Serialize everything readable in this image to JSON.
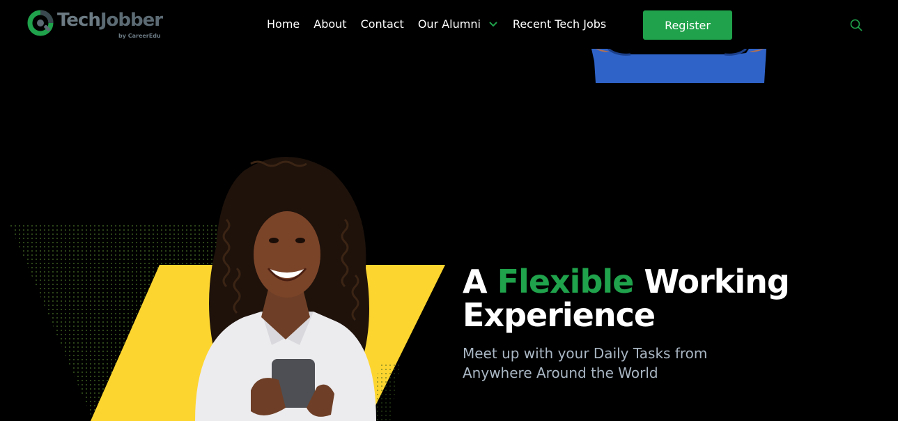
{
  "brand": {
    "name_part1": "Tech",
    "name_part2": "Jobber",
    "sub": "by CareerEdu",
    "accent_color": "#1fa24b"
  },
  "nav": {
    "items": [
      {
        "label": "Home"
      },
      {
        "label": "About"
      },
      {
        "label": "Contact"
      },
      {
        "label": "Our Alumni",
        "has_dropdown": true
      },
      {
        "label": "Recent Tech Jobs"
      }
    ],
    "register_label": "Register",
    "search_icon": "search-icon"
  },
  "hero": {
    "headline_a": "A ",
    "headline_highlight": "Flexible",
    "headline_b": " Working",
    "headline_line2": "Experience",
    "subtext_line1": "Meet up with your Daily Tasks from",
    "subtext_line2": "Anywhere Around the World"
  }
}
